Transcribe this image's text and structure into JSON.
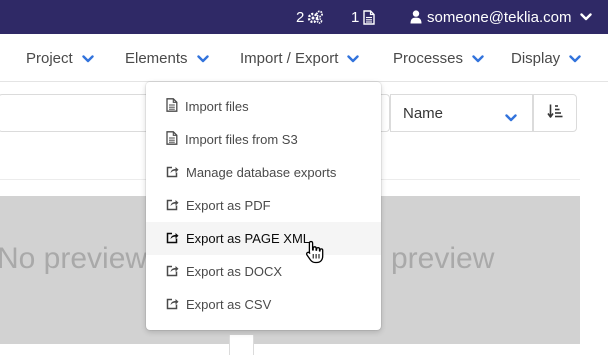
{
  "topbar": {
    "jobs_count": "2",
    "imports_count": "1",
    "user_email": "someone@teklia.com",
    "icons": [
      "gears-icon",
      "file-icon",
      "user-icon",
      "chevron-down-icon"
    ]
  },
  "navbar": {
    "items": [
      {
        "label": "Project"
      },
      {
        "label": "Elements"
      },
      {
        "label": "Import / Export"
      },
      {
        "label": "Processes"
      },
      {
        "label": "Display"
      }
    ]
  },
  "toolbar": {
    "sort_label": "Name"
  },
  "import_export_menu": {
    "items": [
      {
        "label": "Import files",
        "icon": "file-icon"
      },
      {
        "label": "Import files from S3",
        "icon": "file-icon"
      },
      {
        "label": "Manage database exports",
        "icon": "share-icon"
      },
      {
        "label": "Export as PDF",
        "icon": "share-icon"
      },
      {
        "label": "Export as PAGE XML",
        "icon": "share-icon",
        "hovered": true
      },
      {
        "label": "Export as DOCX",
        "icon": "share-icon"
      },
      {
        "label": "Export as CSV",
        "icon": "share-icon"
      }
    ]
  },
  "previews": {
    "left_text": "No preview",
    "right_text": "preview"
  },
  "colors": {
    "topbar_bg": "#2f2966",
    "accent": "#3273dc",
    "preview_bg": "#d2d2d2",
    "hover_bg": "#f5f5f5"
  }
}
